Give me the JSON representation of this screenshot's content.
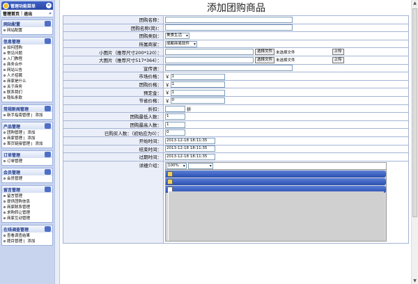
{
  "sidebar": {
    "title": "管理功能菜单",
    "links": {
      "home": "管理首页",
      "logout": "退出"
    },
    "sections": [
      {
        "title": "网站配置",
        "items": [
          {
            "label": "网站配置"
          }
        ]
      },
      {
        "title": "信息管理",
        "items": [
          {
            "label": "如何团购"
          },
          {
            "label": "常见问题"
          },
          {
            "label": "入门教程"
          },
          {
            "label": "商务合作"
          },
          {
            "label": "网站公告"
          },
          {
            "label": "人才招聘"
          },
          {
            "label": "商家是什么"
          },
          {
            "label": "关于商务"
          },
          {
            "label": "联系我们"
          },
          {
            "label": "隐私条款"
          }
        ]
      },
      {
        "title": "常规新闻管理",
        "items": [
          {
            "label": "新手指南管理",
            "add": "添加"
          }
        ]
      },
      {
        "title": "产品管理",
        "items": [
          {
            "label": "团购管理",
            "add": "添加"
          },
          {
            "label": "商家管理",
            "add": "添加"
          },
          {
            "label": "首页链接管理",
            "add": "添加"
          }
        ]
      },
      {
        "title": "订单管理",
        "items": [
          {
            "label": "订单管理"
          }
        ]
      },
      {
        "title": "会员管理",
        "items": [
          {
            "label": "会员管理"
          }
        ]
      },
      {
        "title": "留言管理",
        "items": [
          {
            "label": "留言管理"
          },
          {
            "label": "提供团购信息"
          },
          {
            "label": "商家联系管理"
          },
          {
            "label": "求购转让管理"
          },
          {
            "label": "商家互动管理"
          }
        ]
      },
      {
        "title": "在线调查管理",
        "items": [
          {
            "label": "查看调查结果"
          },
          {
            "label": "题目管理",
            "add": "添加"
          }
        ]
      }
    ]
  },
  "main": {
    "title": "添加团购商品",
    "rows": [
      {
        "label": "团购名称：",
        "type": "input",
        "value": ""
      },
      {
        "label": "团购名称(简)：",
        "type": "input",
        "value": ""
      },
      {
        "label": "团购类别：",
        "type": "select",
        "value": "美食生活"
      },
      {
        "label": "所属商家：",
        "type": "select",
        "value": "成都商易软件"
      },
      {
        "label": "小图片（推荐尺寸200*120）：",
        "type": "file",
        "value": "",
        "choose": "选择文件",
        "nofile": "未选择文件",
        "upload": "上传"
      },
      {
        "label": "大图片（推荐尺寸517*364）：",
        "type": "file",
        "value": "",
        "choose": "选择文件",
        "nofile": "未选择文件",
        "upload": "上传"
      },
      {
        "label": "宣传语：",
        "type": "input",
        "value": ""
      },
      {
        "label": "市场价格：",
        "type": "money",
        "prefix": "￥",
        "value": "1"
      },
      {
        "label": "团购价格：",
        "type": "money",
        "prefix": "￥",
        "value": "1"
      },
      {
        "label": "预定金：",
        "type": "money",
        "prefix": "￥",
        "value": "1"
      },
      {
        "label": "节省价格：",
        "type": "money",
        "prefix": "￥",
        "value": "0"
      },
      {
        "label": "折扣：",
        "type": "discount",
        "value": "",
        "suffix": "折"
      },
      {
        "label": "团购最低人数：",
        "type": "small",
        "value": "1"
      },
      {
        "label": "团购最高人数：",
        "type": "small",
        "value": "1"
      },
      {
        "label": "已购买人数：（初始应为0）：",
        "type": "small",
        "value": "0"
      },
      {
        "label": "开始时间：",
        "type": "date",
        "value": "2013-12-18 18:11:35"
      },
      {
        "label": "结束时间：",
        "type": "date",
        "value": "2013-12-18 18:11:35"
      },
      {
        "label": "过期时间：",
        "type": "date",
        "value": "2013-12-18 18:11:35"
      }
    ],
    "detail": {
      "label": "详细介绍：",
      "zoom": "100%",
      "font": ""
    }
  }
}
